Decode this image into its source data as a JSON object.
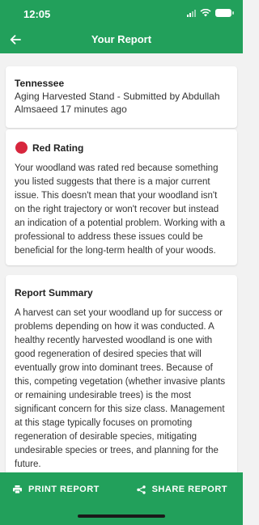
{
  "status": {
    "time": "12:05"
  },
  "nav": {
    "title": "Your Report"
  },
  "stand": {
    "location": "Tennessee",
    "subtitle": "Aging Harvested Stand - Submitted by Abdullah Almsaeed 17 minutes ago"
  },
  "rating": {
    "label": "Red Rating",
    "color": "#d7263d",
    "description": "Your woodland was rated red because something you listed suggests that there is a major current issue. This doesn't mean that your woodland isn't on the right trajectory or won't recover but instead an indication of a potential problem. Working with a professional to address these issues could be beneficial for the long-term health of your woods."
  },
  "summary": {
    "title": "Report Summary",
    "text": "A harvest can set your woodland up for success or problems depending on how it was conducted. A healthy recently harvested woodland is one with good regeneration of desired species that will eventually grow into dominant trees. Because of this, competing vegetation (whether invasive plants or remaining undesirable trees) is the most significant concern for this size class. Management at this stage typically focuses on promoting regeneration of desirable species, mitigating undesirable species or trees, and planning for the future."
  },
  "footer": {
    "print_label": "PRINT REPORT",
    "share_label": "SHARE REPORT"
  },
  "colors": {
    "brand": "#22a05b",
    "background": "#f2f2f2"
  },
  "icons": {
    "back": "arrow-left-icon",
    "print": "printer-icon",
    "share": "share-icon"
  }
}
